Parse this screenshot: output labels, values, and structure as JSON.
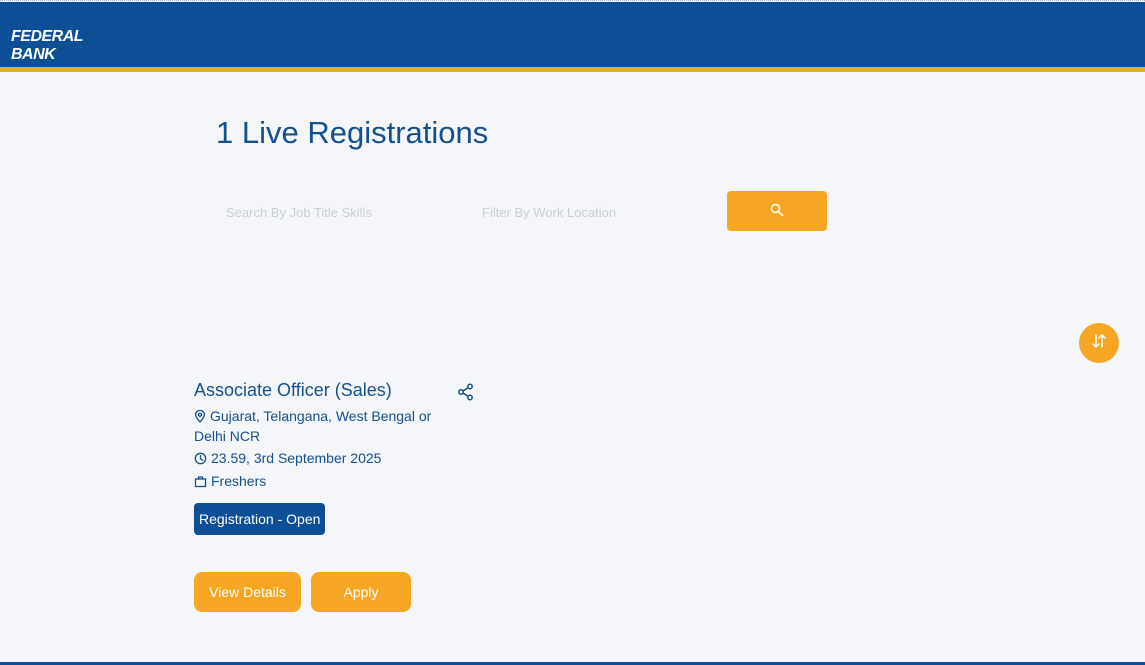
{
  "header": {
    "logo_text": "FEDERAL BANK"
  },
  "page": {
    "title": "1 Live Registrations"
  },
  "search": {
    "keyword_placeholder": "Search By Job Title Skills",
    "location_placeholder": "Filter By Work Location"
  },
  "job": {
    "title": "Associate Officer (Sales)",
    "location": "Gujarat, Telangana, West Bengal or Delhi NCR",
    "deadline": "23.59, 3rd September 2025",
    "experience": "Freshers",
    "status": "Registration - Open",
    "view_details_label": "View Details",
    "apply_label": "Apply"
  },
  "icons": {
    "search": "search-icon",
    "sort": "sort-icon",
    "share": "share-icon",
    "location": "location-pin-icon",
    "clock": "clock-icon",
    "briefcase": "briefcase-icon"
  },
  "colors": {
    "brand_blue": "#0c4f96",
    "accent_orange": "#f6a623",
    "title_blue": "#15508f"
  }
}
